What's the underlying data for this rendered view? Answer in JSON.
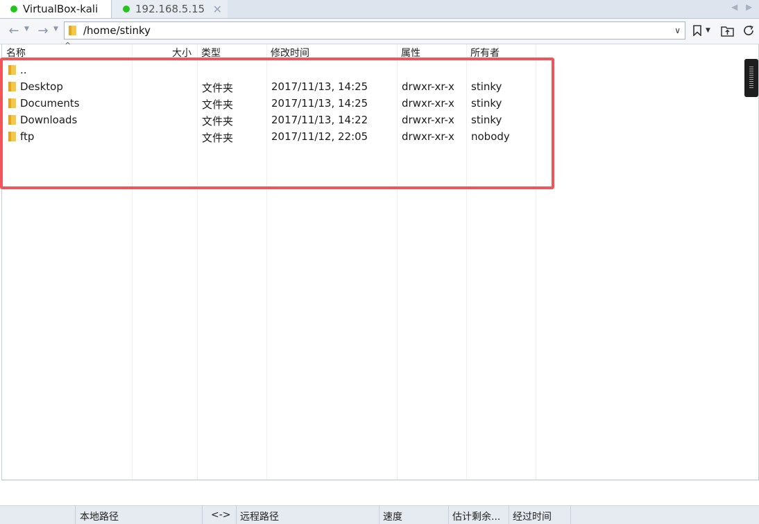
{
  "tabs": [
    {
      "label": "VirtualBox-kali",
      "status_color": "#22c41d"
    },
    {
      "label": "192.168.5.15",
      "status_color": "#22c41d",
      "close_icon": "close-icon"
    }
  ],
  "toolbar": {
    "path": "/home/stinky"
  },
  "file_list": {
    "columns": [
      "名称",
      "大小",
      "类型",
      "修改时间",
      "属性",
      "所有者"
    ],
    "rows": [
      {
        "name": "..",
        "size": "",
        "type": "",
        "modified": "",
        "perms": "",
        "owner": ""
      },
      {
        "name": "Desktop",
        "size": "",
        "type": "文件夹",
        "modified": "2017/11/13, 14:25",
        "perms": "drwxr-xr-x",
        "owner": "stinky"
      },
      {
        "name": "Documents",
        "size": "",
        "type": "文件夹",
        "modified": "2017/11/13, 14:25",
        "perms": "drwxr-xr-x",
        "owner": "stinky"
      },
      {
        "name": "Downloads",
        "size": "",
        "type": "文件夹",
        "modified": "2017/11/13, 14:22",
        "perms": "drwxr-xr-x",
        "owner": "stinky"
      },
      {
        "name": "ftp",
        "size": "",
        "type": "文件夹",
        "modified": "2017/11/12, 22:05",
        "perms": "drwxr-xr-x",
        "owner": "nobody"
      }
    ]
  },
  "queue": {
    "local_path": "本地路径",
    "direction": "<->",
    "remote_path": "远程路径",
    "speed": "速度",
    "remaining": "估计剩余...",
    "elapsed": "经过时间"
  },
  "colors": {
    "highlight": "#f0555a",
    "folder": "#f3c84a"
  }
}
